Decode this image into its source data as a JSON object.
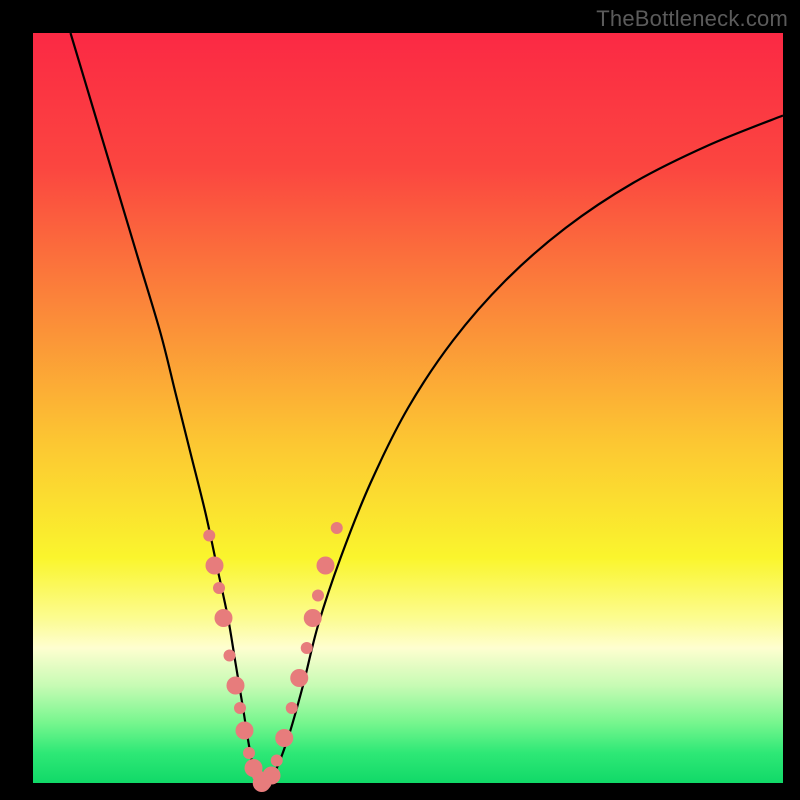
{
  "watermark": "TheBottleneck.com",
  "gradient": {
    "stops": [
      {
        "pct": 0,
        "color": "#fb2944"
      },
      {
        "pct": 18,
        "color": "#fb4640"
      },
      {
        "pct": 38,
        "color": "#fb8c39"
      },
      {
        "pct": 55,
        "color": "#fcc832"
      },
      {
        "pct": 70,
        "color": "#faf52d"
      },
      {
        "pct": 78,
        "color": "#fcfc90"
      },
      {
        "pct": 82,
        "color": "#fefed0"
      },
      {
        "pct": 87,
        "color": "#c7fbb4"
      },
      {
        "pct": 92,
        "color": "#76f68e"
      },
      {
        "pct": 96,
        "color": "#2ee876"
      },
      {
        "pct": 100,
        "color": "#11d968"
      }
    ]
  },
  "curve_style": {
    "stroke": "#000000",
    "stroke_width": 2.2
  },
  "marker_style": {
    "fill": "#e77c7c",
    "radius_small": 6,
    "radius_large": 9
  },
  "chart_data": {
    "type": "line",
    "title": "",
    "xlabel": "",
    "ylabel": "",
    "xlim": [
      0,
      100
    ],
    "ylim": [
      0,
      100
    ],
    "annotations": [
      "TheBottleneck.com"
    ],
    "series": [
      {
        "name": "bottleneck-curve",
        "x": [
          5,
          8,
          11,
          14,
          17,
          19,
          21,
          23,
          24.5,
          26,
          27,
          28,
          28.8,
          29.6,
          30.5,
          32,
          34,
          36,
          38,
          41,
          45,
          50,
          56,
          63,
          71,
          80,
          90,
          100
        ],
        "y": [
          100,
          90,
          80,
          70,
          60,
          52,
          44,
          36,
          29,
          22,
          16,
          10,
          5,
          1,
          0,
          1,
          6,
          13,
          21,
          30,
          40,
          50,
          59,
          67,
          74,
          80,
          85,
          89
        ]
      }
    ],
    "markers": [
      {
        "x": 23.5,
        "y": 33,
        "r": "small"
      },
      {
        "x": 24.2,
        "y": 29,
        "r": "large"
      },
      {
        "x": 24.8,
        "y": 26,
        "r": "small"
      },
      {
        "x": 25.4,
        "y": 22,
        "r": "large"
      },
      {
        "x": 26.2,
        "y": 17,
        "r": "small"
      },
      {
        "x": 27.0,
        "y": 13,
        "r": "large"
      },
      {
        "x": 27.6,
        "y": 10,
        "r": "small"
      },
      {
        "x": 28.2,
        "y": 7,
        "r": "large"
      },
      {
        "x": 28.8,
        "y": 4,
        "r": "small"
      },
      {
        "x": 29.4,
        "y": 2,
        "r": "large"
      },
      {
        "x": 30.0,
        "y": 1,
        "r": "small"
      },
      {
        "x": 30.5,
        "y": 0,
        "r": "large"
      },
      {
        "x": 31.0,
        "y": 0,
        "r": "small"
      },
      {
        "x": 31.8,
        "y": 1,
        "r": "large"
      },
      {
        "x": 32.5,
        "y": 3,
        "r": "small"
      },
      {
        "x": 33.5,
        "y": 6,
        "r": "large"
      },
      {
        "x": 34.5,
        "y": 10,
        "r": "small"
      },
      {
        "x": 35.5,
        "y": 14,
        "r": "large"
      },
      {
        "x": 36.5,
        "y": 18,
        "r": "small"
      },
      {
        "x": 37.3,
        "y": 22,
        "r": "large"
      },
      {
        "x": 38.0,
        "y": 25,
        "r": "small"
      },
      {
        "x": 39.0,
        "y": 29,
        "r": "large"
      },
      {
        "x": 40.5,
        "y": 34,
        "r": "small"
      }
    ]
  }
}
